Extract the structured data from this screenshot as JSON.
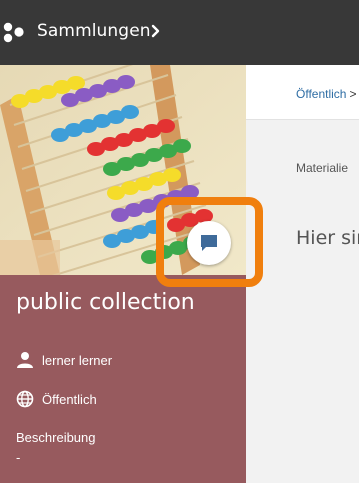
{
  "topbar": {
    "title": "Sammlungen",
    "logo_icon": "cluster-dots-icon",
    "chevron_icon": "chevron-right-icon",
    "background_color": "#383838"
  },
  "collection": {
    "title": "public collection",
    "owner": "lerner lerner",
    "owner_icon": "person-icon",
    "visibility": "Öffentlich",
    "visibility_icon": "globe-icon",
    "description_label": "Beschreibung",
    "description_value": "-",
    "panel_color": "#975a5e",
    "comment_icon": "comment-icon"
  },
  "content": {
    "breadcrumb": "Öffentlich",
    "breadcrumb_separator": ">",
    "materials_label": "Materialie",
    "empty_message": "Hier sin"
  },
  "highlight_color": "#f07f0e"
}
